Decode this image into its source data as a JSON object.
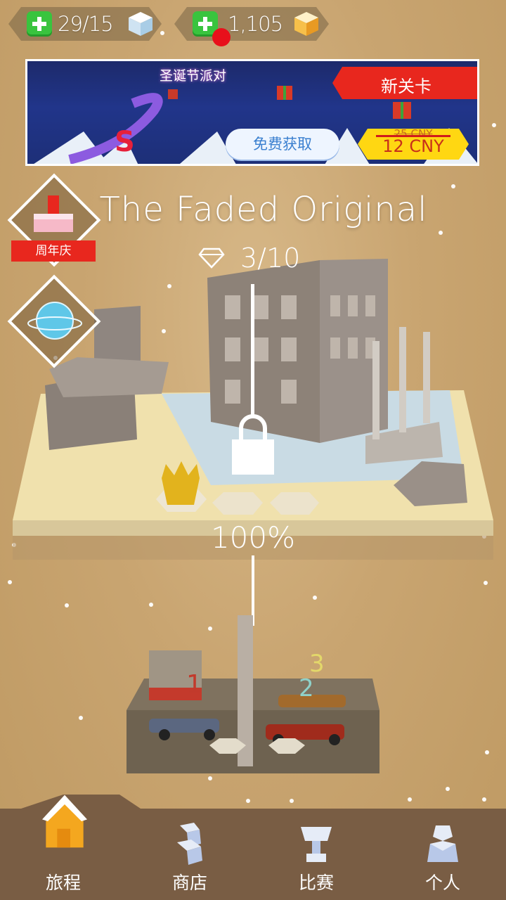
{
  "header": {
    "lives": "29/15",
    "diamonds": "1,105"
  },
  "banner": {
    "title": "圣诞节派对",
    "new_level": "新关卡",
    "free_button": "免费获取",
    "price_old": "25 CNY",
    "price_new": "12 CNY"
  },
  "badges": {
    "anniversary_label": "周年庆"
  },
  "level": {
    "title": "The Faded Original",
    "gems": "3/10",
    "progress": "100%"
  },
  "nav": {
    "items": [
      {
        "label": "旅程",
        "icon": "house-icon"
      },
      {
        "label": "商店",
        "icon": "shop-icon"
      },
      {
        "label": "比赛",
        "icon": "trophy-icon"
      },
      {
        "label": "个人",
        "icon": "profile-icon"
      }
    ]
  },
  "colors": {
    "background": "#c9a673",
    "nav_bg": "#795d44",
    "accent_red": "#e8271e",
    "accent_green": "#39c43e",
    "price_yellow": "#ffd712"
  }
}
